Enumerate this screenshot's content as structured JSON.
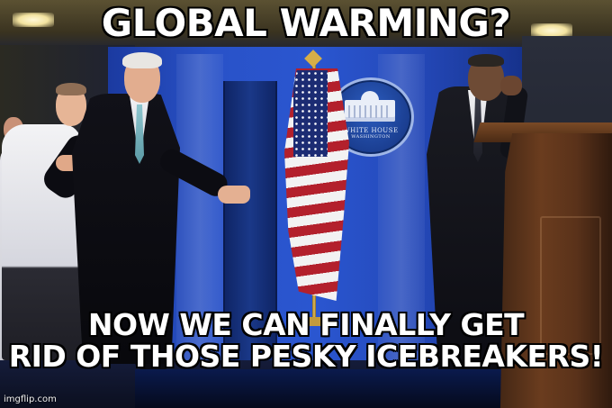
{
  "meme": {
    "top_text": "GLOBAL WARMING?",
    "bottom_text_line1": "NOW WE CAN FINALLY GET",
    "bottom_text_line2": "RID OF THOSE PESKY ICEBREAKERS!",
    "watermark": "imgflip.com"
  },
  "scene": {
    "seal_text": "WHITE HOUSE",
    "seal_subtext": "WASHINGTON",
    "wall_color": "#2a56d0",
    "podium_color": "#6a3c1e"
  }
}
